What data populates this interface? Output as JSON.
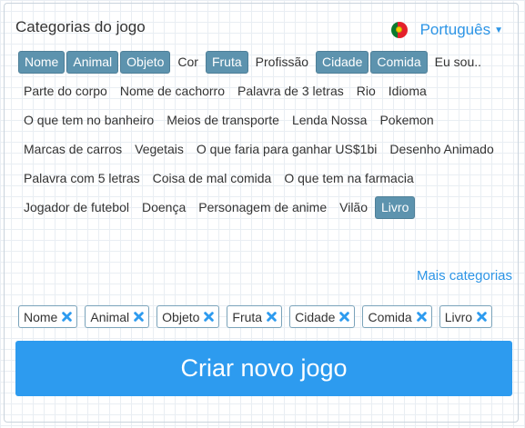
{
  "header": {
    "title": "Categorias do jogo",
    "language": "Português",
    "flag_icon": "portugal-flag-icon"
  },
  "categories": [
    {
      "label": "Nome",
      "selected": true
    },
    {
      "label": "Animal",
      "selected": true
    },
    {
      "label": "Objeto",
      "selected": true
    },
    {
      "label": "Cor",
      "selected": false
    },
    {
      "label": "Fruta",
      "selected": true
    },
    {
      "label": "Profissão",
      "selected": false
    },
    {
      "label": "Cidade",
      "selected": true
    },
    {
      "label": "Comida",
      "selected": true
    },
    {
      "label": "Eu sou..",
      "selected": false
    },
    {
      "label": "Parte do corpo",
      "selected": false
    },
    {
      "label": "Nome de cachorro",
      "selected": false
    },
    {
      "label": "Palavra de 3 letras",
      "selected": false
    },
    {
      "label": "Rio",
      "selected": false
    },
    {
      "label": "Idioma",
      "selected": false
    },
    {
      "label": "O que tem no banheiro",
      "selected": false
    },
    {
      "label": "Meios de transporte",
      "selected": false
    },
    {
      "label": "Lenda Nossa",
      "selected": false
    },
    {
      "label": "Pokemon",
      "selected": false
    },
    {
      "label": "Marcas de carros",
      "selected": false
    },
    {
      "label": "Vegetais",
      "selected": false
    },
    {
      "label": "O que faria para ganhar US$1bi",
      "selected": false
    },
    {
      "label": "Desenho Animado",
      "selected": false
    },
    {
      "label": "Palavra com 5 letras",
      "selected": false
    },
    {
      "label": "Coisa de mal comida",
      "selected": false
    },
    {
      "label": "O que tem na farmacia",
      "selected": false
    },
    {
      "label": "Jogador de futebol",
      "selected": false
    },
    {
      "label": "Doença",
      "selected": false
    },
    {
      "label": "Personagem de anime",
      "selected": false
    },
    {
      "label": "Vilão",
      "selected": false
    },
    {
      "label": "Livro",
      "selected": true
    }
  ],
  "more_categories": "Mais categorias",
  "selected_chips": [
    "Nome",
    "Animal",
    "Objeto",
    "Fruta",
    "Cidade",
    "Comida",
    "Livro"
  ],
  "create_button": "Criar novo jogo",
  "colors": {
    "accent": "#2d9bef",
    "selected_bg": "#5d93ae",
    "link": "#2d95e6"
  }
}
